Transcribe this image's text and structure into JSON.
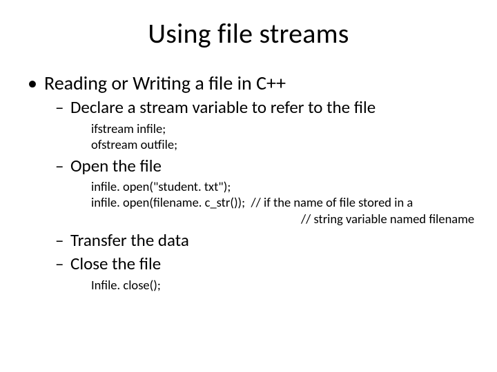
{
  "title": "Using file streams",
  "bullet1": "•",
  "dash": "–",
  "l1": {
    "text": "Reading or Writing a file in C++"
  },
  "l2": {
    "a": "Declare a stream variable to refer to the file",
    "b": "Open the file",
    "c": "Transfer the data",
    "d": "Close the file"
  },
  "code": {
    "declare1": "ifstream infile;",
    "declare2": "ofstream outfile;",
    "open1": "infile. open(\"student. txt\");",
    "open2": "infile. open(filename. c_str());  // if the name of file stored in a",
    "open3": "// string variable named filename",
    "close1": "Infile. close();"
  }
}
